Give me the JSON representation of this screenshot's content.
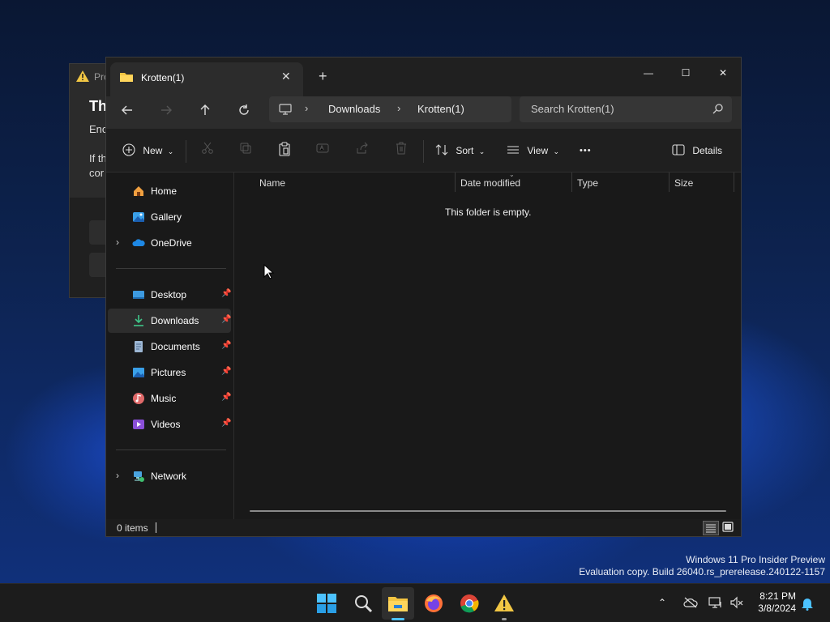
{
  "desktop": {
    "watermark_line1": "Windows 11 Pro Insider Preview",
    "watermark_line2": "Evaluation copy. Build 26040.rs_prerelease.240122-1157"
  },
  "background_dialog": {
    "title_fragment": "Pro",
    "heading_fragment": "Th",
    "line1_fragment": "Enc",
    "line2_fragment": "If th",
    "line3_fragment": "cor"
  },
  "explorer": {
    "tab_title": "Krotten(1)",
    "tab_close": "✕",
    "new_tab": "+",
    "window_controls": {
      "minimize": "—",
      "maximize": "☐",
      "close": "✕"
    },
    "address": {
      "crumbs": [
        "Downloads",
        "Krotten(1)"
      ]
    },
    "search_placeholder": "Search Krotten(1)",
    "toolbar": {
      "new_label": "New",
      "sort_label": "Sort",
      "view_label": "View",
      "more_label": "•••",
      "details_label": "Details"
    },
    "sidebar": {
      "items": [
        {
          "label": "Home",
          "icon": "home-icon"
        },
        {
          "label": "Gallery",
          "icon": "gallery-icon"
        },
        {
          "label": "OneDrive",
          "icon": "cloud-icon"
        },
        {
          "label": "Desktop",
          "icon": "desktop-icon"
        },
        {
          "label": "Downloads",
          "icon": "download-icon"
        },
        {
          "label": "Documents",
          "icon": "document-icon"
        },
        {
          "label": "Pictures",
          "icon": "pictures-icon"
        },
        {
          "label": "Music",
          "icon": "music-icon"
        },
        {
          "label": "Videos",
          "icon": "video-icon"
        },
        {
          "label": "Network",
          "icon": "network-icon"
        }
      ]
    },
    "columns": [
      "Name",
      "Date modified",
      "Type",
      "Size"
    ],
    "empty_message": "This folder is empty.",
    "status_count": "0 items"
  },
  "taskbar": {
    "time": "8:21 PM",
    "date": "3/8/2024"
  }
}
